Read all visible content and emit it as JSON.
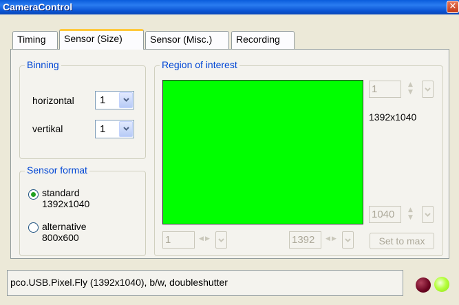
{
  "window": {
    "title": "CameraControl",
    "close_glyph": "✕"
  },
  "tabs": [
    {
      "label": "Timing"
    },
    {
      "label": "Sensor (Size)",
      "active": true
    },
    {
      "label": "Sensor (Misc.)"
    },
    {
      "label": "Recording"
    }
  ],
  "binning": {
    "title": "Binning",
    "horizontal_label": "horizontal",
    "horizontal_value": "1",
    "vertical_label": "vertikal",
    "vertical_value": "1"
  },
  "sensor_format": {
    "title": "Sensor format",
    "options": [
      {
        "label": "standard",
        "detail": "1392x1040",
        "selected": true
      },
      {
        "label": "alternative",
        "detail": "800x600",
        "selected": false
      }
    ]
  },
  "roi": {
    "title": "Region of interest",
    "top_value": "1",
    "bottom_value": "1040",
    "left_value": "1",
    "right_value": "1392",
    "size_text": "1392x1040",
    "fill_color": "#00ff00",
    "set_max_label": "Set to max"
  },
  "status": {
    "text": "pco.USB.Pixel.Fly (1392x1040), b/w, doubleshutter",
    "led_colors": [
      "#6a0420",
      "#b6ff40"
    ]
  },
  "colors": {
    "accent": "#0046d5",
    "tab_highlight": "#ffc83c"
  }
}
